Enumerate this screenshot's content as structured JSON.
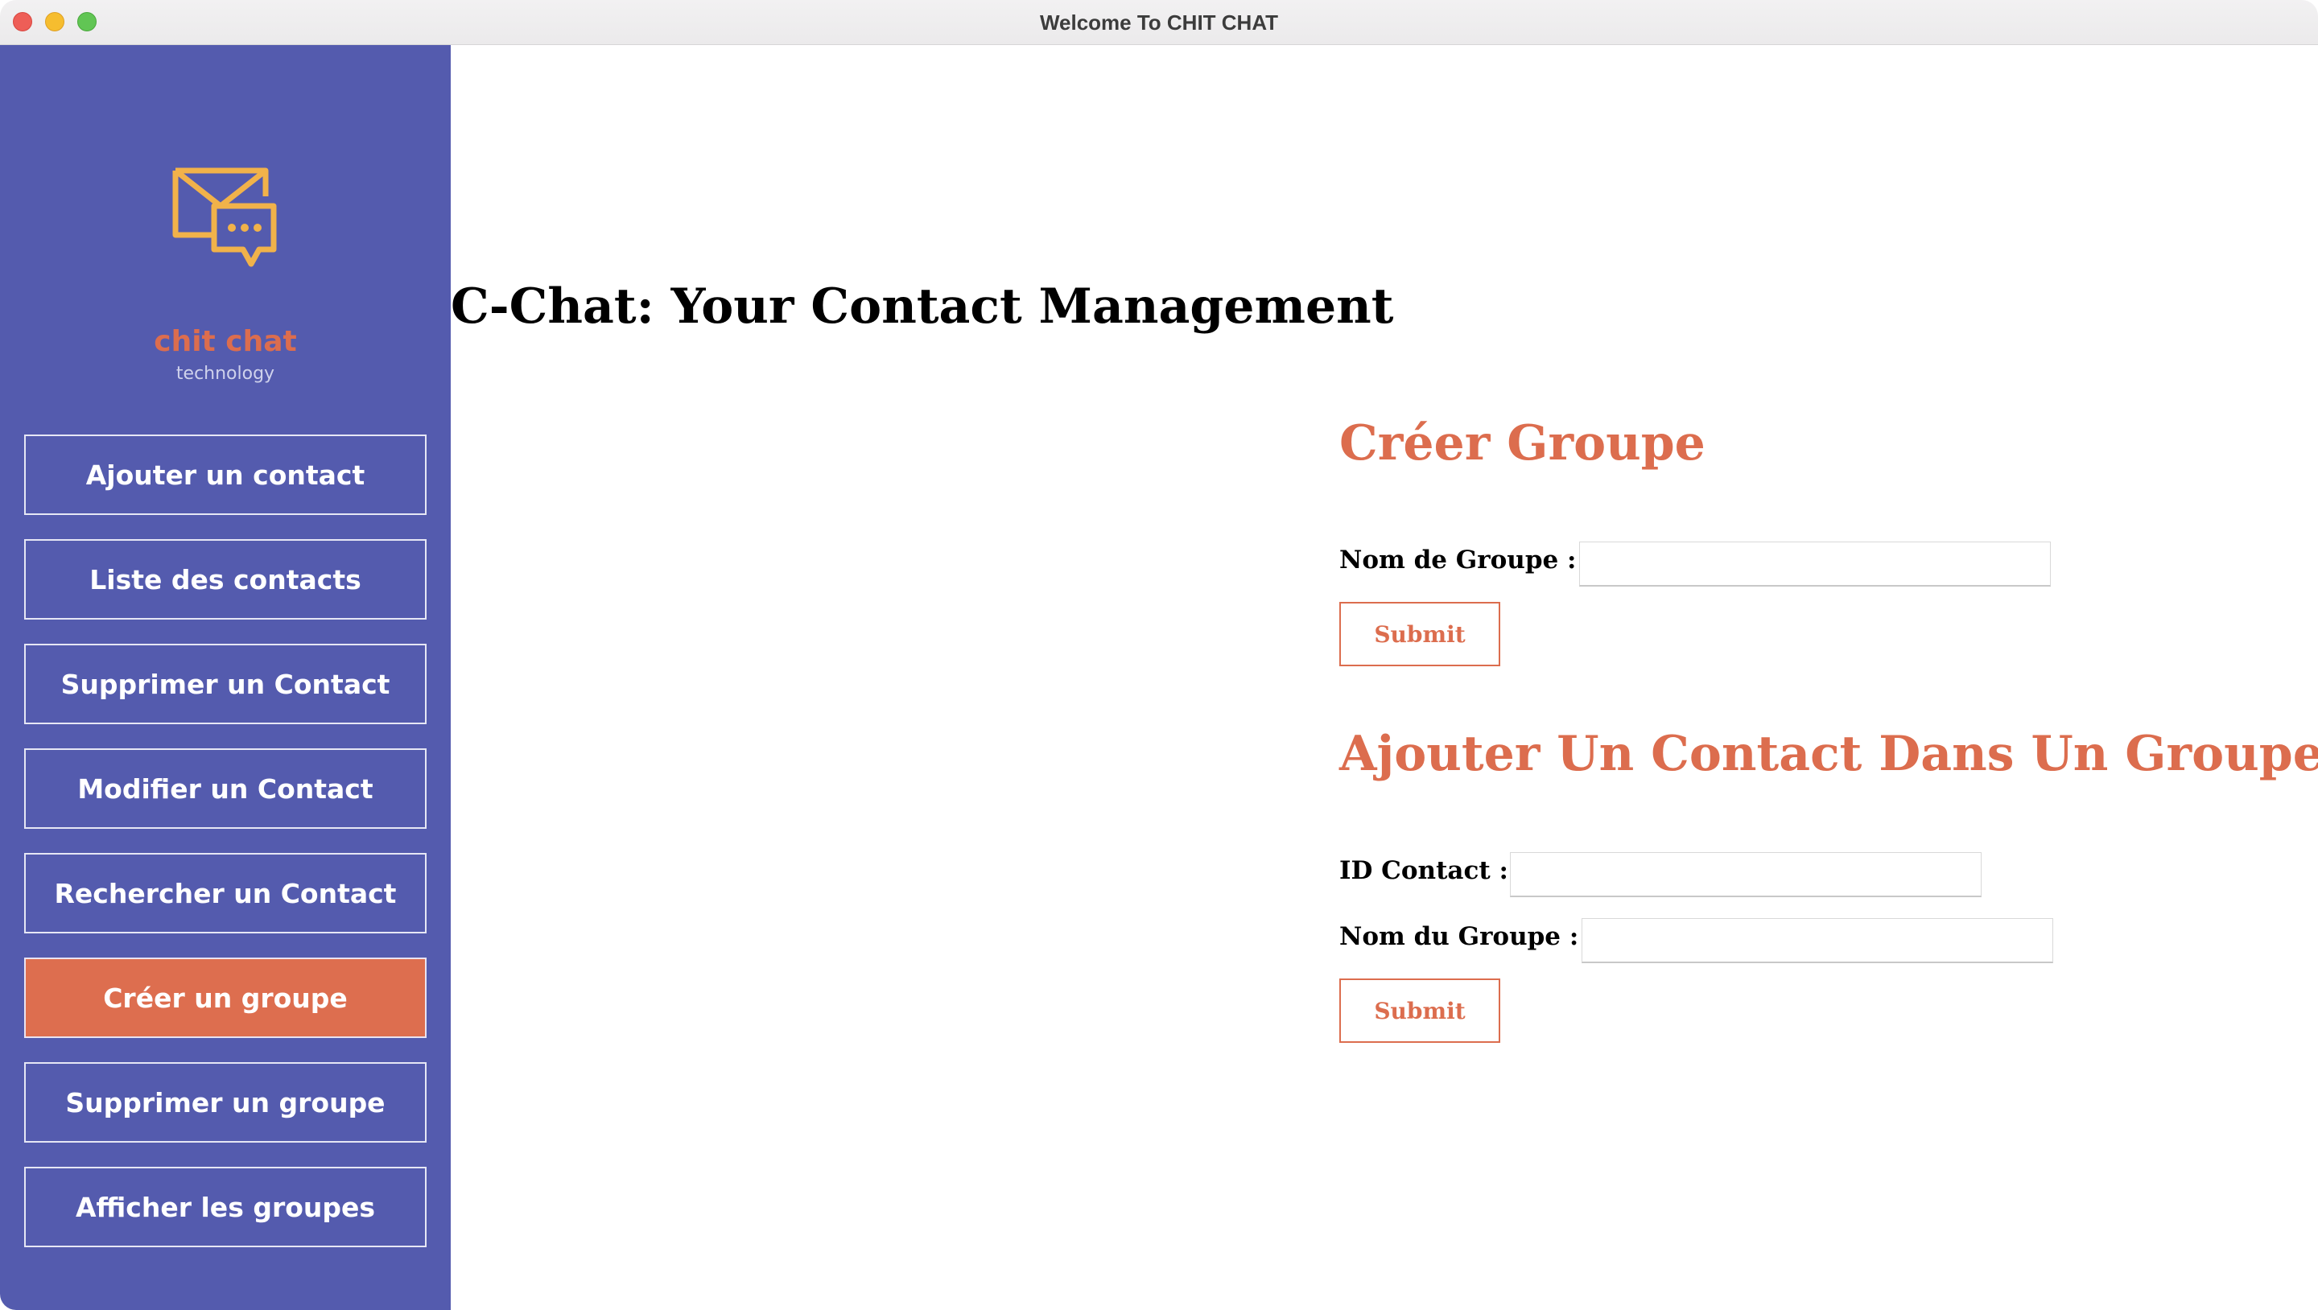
{
  "window": {
    "title": "Welcome To CHIT CHAT"
  },
  "sidebar": {
    "logo": {
      "name": "chit chat",
      "subtitle": "technology",
      "icon": "envelope-chat-icon",
      "icon_color": "#f1b24a"
    },
    "items": [
      {
        "label": "Ajouter un contact",
        "active": false
      },
      {
        "label": "Liste des contacts",
        "active": false
      },
      {
        "label": "Supprimer un Contact",
        "active": false
      },
      {
        "label": "Modifier un Contact",
        "active": false
      },
      {
        "label": "Rechercher un Contact",
        "active": false
      },
      {
        "label": "Créer un groupe",
        "active": true
      },
      {
        "label": "Supprimer un groupe",
        "active": false
      },
      {
        "label": "Afficher les groupes",
        "active": false
      }
    ]
  },
  "main": {
    "page_title": "C-Chat: Your Contact Management",
    "create_group": {
      "title": "Créer Groupe",
      "name_label": "Nom de Groupe :",
      "name_value": "",
      "submit_label": "Submit"
    },
    "add_contact_to_group": {
      "title": "Ajouter Un Contact Dans Un Groupe",
      "contact_id_label": "ID Contact :",
      "contact_id_value": "",
      "group_name_label": "Nom du Groupe :",
      "group_name_value": "",
      "submit_label": "Submit"
    }
  },
  "colors": {
    "sidebar_bg": "#545bae",
    "accent": "#dc6d4e",
    "active_item_bg": "#dd6e4f"
  }
}
